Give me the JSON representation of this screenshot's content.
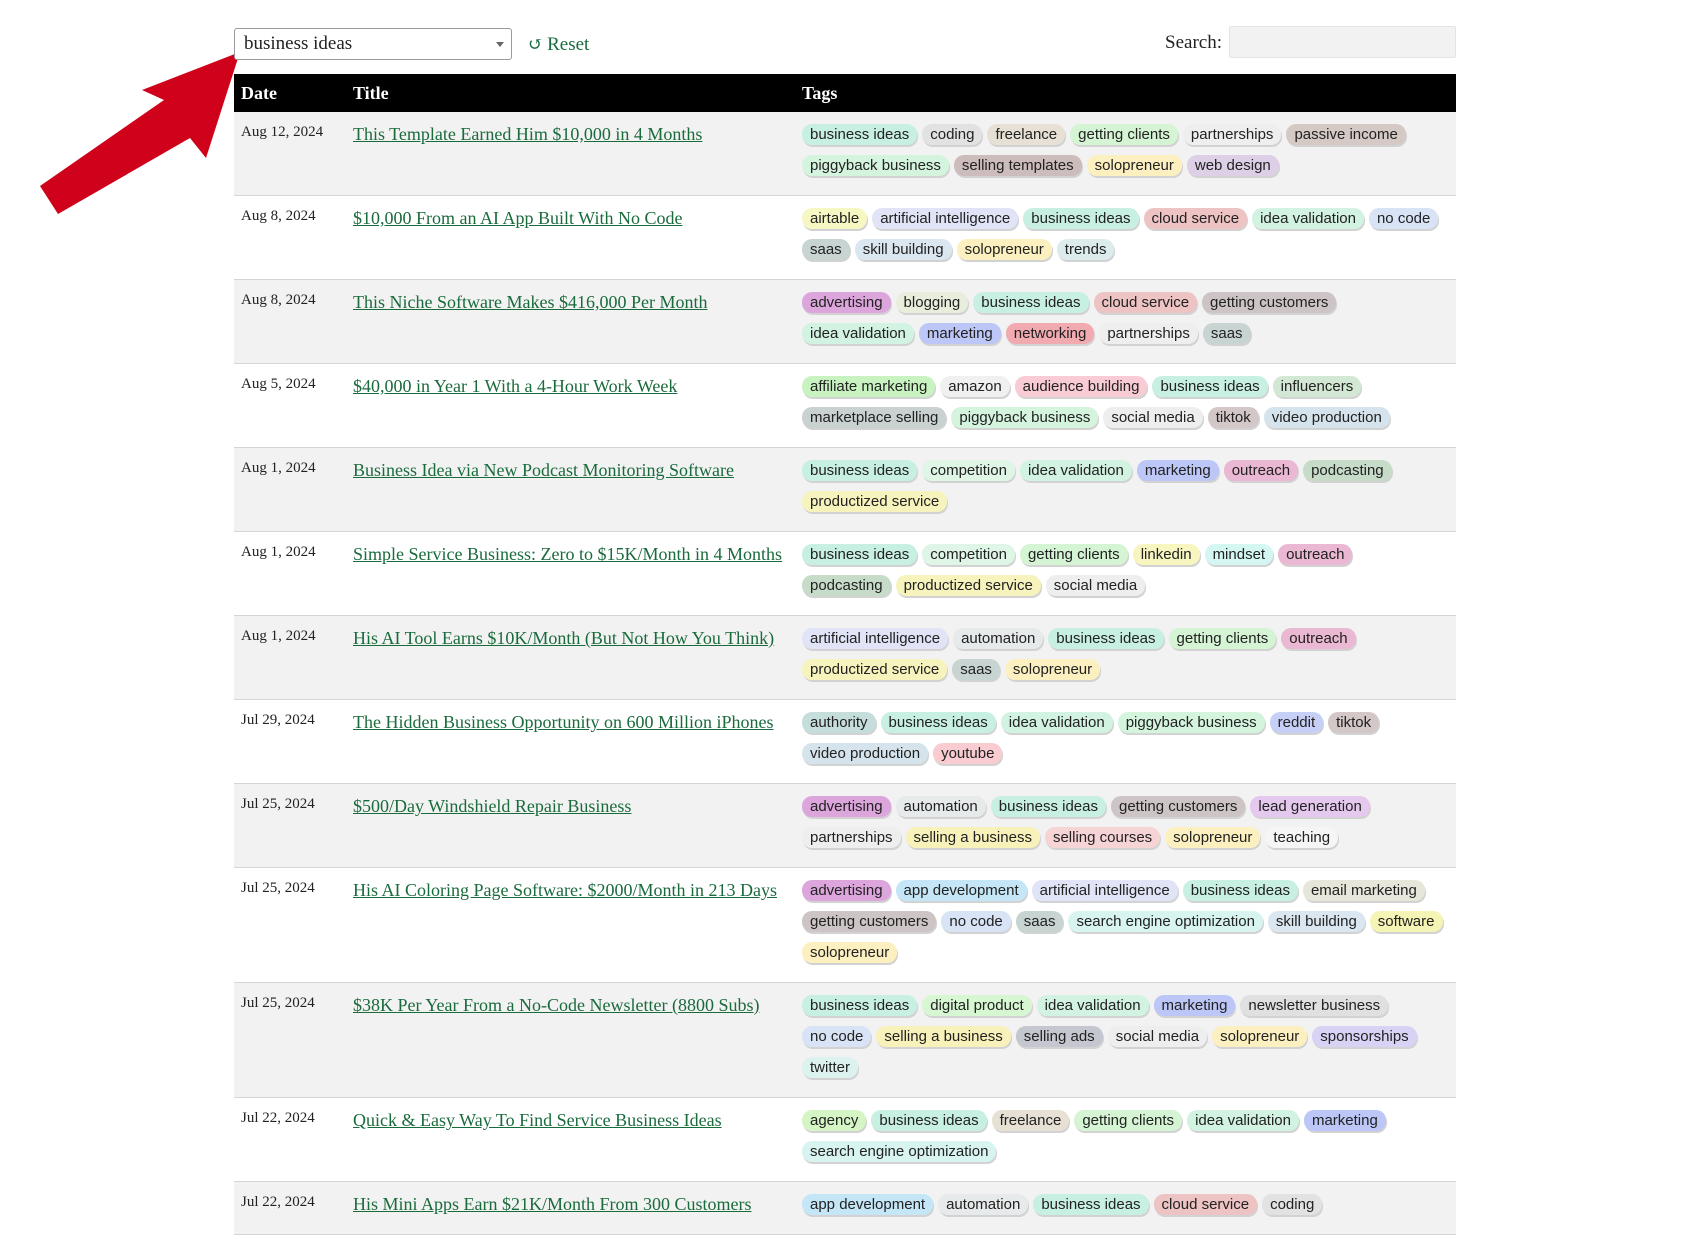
{
  "filter": {
    "selected": "business ideas"
  },
  "reset": {
    "label": "Reset"
  },
  "search": {
    "label": "Search:",
    "value": ""
  },
  "table": {
    "headers": [
      "Date",
      "Title",
      "Tags"
    ],
    "rows": [
      {
        "date": "Aug 12, 2024",
        "title": "This Template Earned Him $10,000 in 4 Months",
        "tags": [
          "business ideas",
          "coding",
          "freelance",
          "getting clients",
          "partnerships",
          "passive income",
          "piggyback business",
          "selling templates",
          "solopreneur",
          "web design"
        ]
      },
      {
        "date": "Aug 8, 2024",
        "title": "$10,000 From an AI App Built With No Code",
        "tags": [
          "airtable",
          "artificial intelligence",
          "business ideas",
          "cloud service",
          "idea validation",
          "no code",
          "saas",
          "skill building",
          "solopreneur",
          "trends"
        ]
      },
      {
        "date": "Aug 8, 2024",
        "title": "This Niche Software Makes $416,000 Per Month",
        "tags": [
          "advertising",
          "blogging",
          "business ideas",
          "cloud service",
          "getting customers",
          "idea validation",
          "marketing",
          "networking",
          "partnerships",
          "saas"
        ]
      },
      {
        "date": "Aug 5, 2024",
        "title": "$40,000 in Year 1 With a 4-Hour Work Week",
        "tags": [
          "affiliate marketing",
          "amazon",
          "audience building",
          "business ideas",
          "influencers",
          "marketplace selling",
          "piggyback business",
          "social media",
          "tiktok",
          "video production"
        ]
      },
      {
        "date": "Aug 1, 2024",
        "title": "Business Idea via New Podcast Monitoring Software",
        "tags": [
          "business ideas",
          "competition",
          "idea validation",
          "marketing",
          "outreach",
          "podcasting",
          "productized service"
        ]
      },
      {
        "date": "Aug 1, 2024",
        "title": "Simple Service Business: Zero to $15K/Month in 4 Months",
        "tags": [
          "business ideas",
          "competition",
          "getting clients",
          "linkedin",
          "mindset",
          "outreach",
          "podcasting",
          "productized service",
          "social media"
        ]
      },
      {
        "date": "Aug 1, 2024",
        "title": "His AI Tool Earns $10K/Month (But Not How You Think)",
        "tags": [
          "artificial intelligence",
          "automation",
          "business ideas",
          "getting clients",
          "outreach",
          "productized service",
          "saas",
          "solopreneur"
        ]
      },
      {
        "date": "Jul 29, 2024",
        "title": "The Hidden Business Opportunity on 600 Million iPhones",
        "tags": [
          "authority",
          "business ideas",
          "idea validation",
          "piggyback business",
          "reddit",
          "tiktok",
          "video production",
          "youtube"
        ]
      },
      {
        "date": "Jul 25, 2024",
        "title": "$500/Day Windshield Repair Business",
        "tags": [
          "advertising",
          "automation",
          "business ideas",
          "getting customers",
          "lead generation",
          "partnerships",
          "selling a business",
          "selling courses",
          "solopreneur",
          "teaching"
        ]
      },
      {
        "date": "Jul 25, 2024",
        "title": "His AI Coloring Page Software: $2000/Month in 213 Days",
        "tags": [
          "advertising",
          "app development",
          "artificial intelligence",
          "business ideas",
          "email marketing",
          "getting customers",
          "no code",
          "saas",
          "search engine optimization",
          "skill building",
          "software",
          "solopreneur"
        ]
      },
      {
        "date": "Jul 25, 2024",
        "title": "$38K Per Year From a No-Code Newsletter (8800 Subs)",
        "tags": [
          "business ideas",
          "digital product",
          "idea validation",
          "marketing",
          "newsletter business",
          "no code",
          "selling a business",
          "selling ads",
          "social media",
          "solopreneur",
          "sponsorships",
          "twitter"
        ]
      },
      {
        "date": "Jul 22, 2024",
        "title": "Quick & Easy Way To Find Service Business Ideas",
        "tags": [
          "agency",
          "business ideas",
          "freelance",
          "getting clients",
          "idea validation",
          "marketing",
          "search engine optimization"
        ]
      },
      {
        "date": "Jul 22, 2024",
        "title": "His Mini Apps Earn $21K/Month From 300 Customers",
        "tags": [
          "app development",
          "automation",
          "business ideas",
          "cloud service",
          "coding"
        ]
      }
    ]
  },
  "tag_colors": {
    "business ideas": "#c8f0e2",
    "coding": "#e2e2e2",
    "freelance": "#e6e1d4",
    "getting clients": "#d4f4d4",
    "partnerships": "#eeeeee",
    "passive income": "#d5c9c6",
    "piggyback business": "#d4f4de",
    "selling templates": "#cdbcbc",
    "solopreneur": "#fdf0c0",
    "web design": "#dccfe6",
    "airtable": "#f7f7c4",
    "artificial intelligence": "#e0e4f6",
    "cloud service": "#eec3c3",
    "idea validation": "#d2f2e2",
    "no code": "#d9e3f6",
    "saas": "#c8d4d2",
    "skill building": "#dae6f0",
    "trends": "#dcecec",
    "advertising": "#dca5dc",
    "blogging": "#e9eedc",
    "getting customers": "#cdc5c5",
    "marketing": "#bcc6f7",
    "networking": "#f1aab0",
    "affiliate marketing": "#c8f2c0",
    "amazon": "#f0f0f0",
    "audience building": "#f9cbd4",
    "influencers": "#d2e8d4",
    "marketplace selling": "#c9d2d0",
    "social media": "#eeeeee",
    "tiktok": "#d3c7c7",
    "video production": "#d5e4ec",
    "competition": "#dff5e6",
    "outreach": "#eab8d2",
    "podcasting": "#c6dcc8",
    "productized service": "#f6f4bc",
    "linkedin": "#f7f5c0",
    "mindset": "#d4f7f4",
    "automation": "#e6eaea",
    "authority": "#c5dedc",
    "reddit": "#c6d0f7",
    "youtube": "#f8ccd0",
    "lead generation": "#e5c8ee",
    "selling a business": "#f8f2ba",
    "selling courses": "#f6d4d6",
    "teaching": "#f5f5f5",
    "app development": "#c4e6f7",
    "email marketing": "#e6e6da",
    "search engine optimization": "#d8f4f0",
    "software": "#f4f4b4",
    "digital product": "#d6f7d2",
    "newsletter business": "#e0e0e0",
    "selling ads": "#c4c7d0",
    "sponsorships": "#d8d3f5",
    "twitter": "#dcf2ee",
    "agency": "#d5f6c4"
  },
  "colors": {
    "header_bg": "#000000",
    "link": "#1a6b3c",
    "arrow": "#d0021b",
    "row_stripe": "#f2f2f2"
  },
  "icons": {
    "reset": "undo-arrow-icon",
    "dropdown": "chevron-down-icon",
    "annotation": "red-arrow-icon"
  }
}
